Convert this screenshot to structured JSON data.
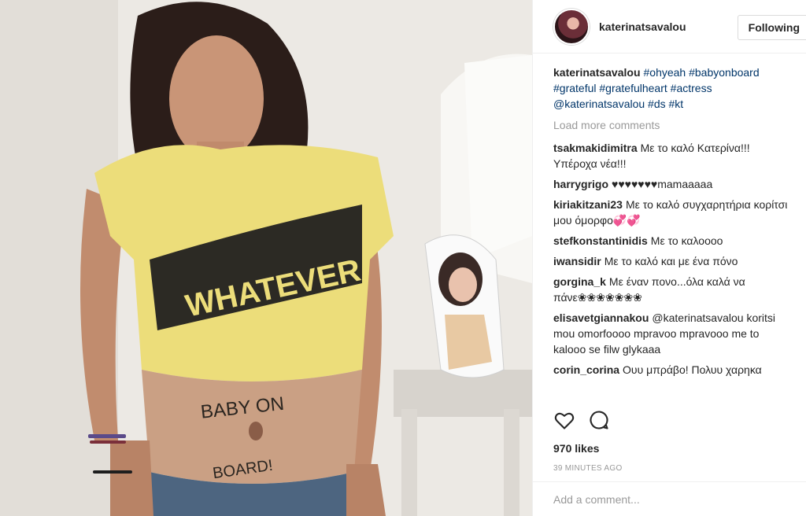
{
  "post": {
    "username": "katerinatsavalou",
    "follow_label": "Following",
    "caption": {
      "user": "katerinatsavalou",
      "text": "#ohyeah #babyonboard #grateful #gratefulheart #actress @katerinatsavalou #ds #kt"
    },
    "load_more": "Load more comments",
    "comments": [
      {
        "user": "tsakmakidimitra",
        "text": "Με το καλό Κατερίνα!!! Υπέροχα νέα!!!"
      },
      {
        "user": "harrygrigo",
        "text": "♥♥♥♥♥♥♥mamaaaaa"
      },
      {
        "user": "kiriakitzani23",
        "text": "Με το καλό συγχαρητήρια κορίτσι μου όμορφο💞💞"
      },
      {
        "user": "stefkonstantinidis",
        "text": "Με το καλοοοο"
      },
      {
        "user": "iwansidir",
        "text": "Με το καλό και με ένα πόνο"
      },
      {
        "user": "gorgina_k",
        "text": "Με έναν πονο...όλα καλά να πάνε❀❀❀❀❀❀❀"
      },
      {
        "user": "elisavetgiannakou",
        "text": "@katerinatsavalou koritsi mou omorfoooo mpravoo mpravooo me to kalooo se filw glykaaa"
      },
      {
        "user": "corin_corina",
        "text": "Ουυ μπράβο! Πολυυ χαρηκα"
      }
    ],
    "likes": "970 likes",
    "time_ago": "39 MINUTES AGO",
    "add_comment_placeholder": "Add a comment..."
  },
  "photo": {
    "shirt_text": "WHATEVER",
    "belly_text_1": "BABY ON",
    "belly_text_2": "BOARD!"
  },
  "icons": {
    "like": "heart-icon",
    "comment": "comment-bubble-icon"
  }
}
